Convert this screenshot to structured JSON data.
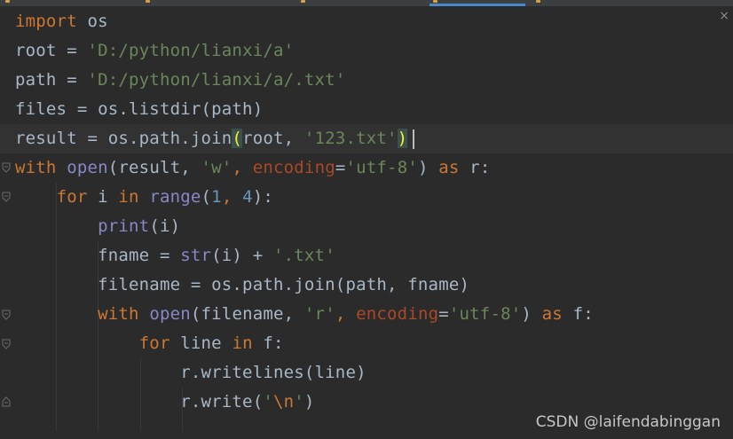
{
  "editor": {
    "close_glyph": "×",
    "lines": [
      {
        "tokens": [
          {
            "t": "import",
            "c": "kw"
          },
          {
            "t": " os",
            "c": ""
          }
        ]
      },
      {
        "tokens": [
          {
            "t": "root = ",
            "c": ""
          },
          {
            "t": "'D:/python/lianxi/a'",
            "c": "str"
          }
        ]
      },
      {
        "tokens": [
          {
            "t": "path = ",
            "c": ""
          },
          {
            "t": "'D:/python/lianxi/a/.txt'",
            "c": "str"
          }
        ]
      },
      {
        "tokens": [
          {
            "t": "files = os.listdir(path)",
            "c": ""
          }
        ]
      },
      {
        "tokens": [
          {
            "t": "result = os.path.join",
            "c": ""
          },
          {
            "t": "(",
            "c": "paren-hl"
          },
          {
            "t": "root, ",
            "c": ""
          },
          {
            "t": "'123.txt'",
            "c": "str"
          },
          {
            "t": ")",
            "c": "paren-hl"
          }
        ],
        "current": true
      },
      {
        "tokens": [
          {
            "t": "with",
            "c": "kw"
          },
          {
            "t": " ",
            "c": ""
          },
          {
            "t": "open",
            "c": "bi"
          },
          {
            "t": "(result, ",
            "c": ""
          },
          {
            "t": "'w'",
            "c": "str"
          },
          {
            "t": ", ",
            "c": "kw"
          },
          {
            "t": "encoding",
            "c": "kwarg"
          },
          {
            "t": "=",
            "c": ""
          },
          {
            "t": "'utf-8'",
            "c": "str"
          },
          {
            "t": ") ",
            "c": ""
          },
          {
            "t": "as",
            "c": "kw"
          },
          {
            "t": " r:",
            "c": ""
          }
        ]
      },
      {
        "tokens": [
          {
            "t": "    ",
            "c": ""
          },
          {
            "t": "for",
            "c": "kw"
          },
          {
            "t": " i ",
            "c": ""
          },
          {
            "t": "in",
            "c": "kw"
          },
          {
            "t": " ",
            "c": ""
          },
          {
            "t": "range",
            "c": "bi"
          },
          {
            "t": "(",
            "c": ""
          },
          {
            "t": "1",
            "c": "num"
          },
          {
            "t": ", ",
            "c": "kw"
          },
          {
            "t": "4",
            "c": "num"
          },
          {
            "t": "):",
            "c": ""
          }
        ]
      },
      {
        "tokens": [
          {
            "t": "        ",
            "c": ""
          },
          {
            "t": "print",
            "c": "bi"
          },
          {
            "t": "(i)",
            "c": ""
          }
        ]
      },
      {
        "tokens": [
          {
            "t": "        fname = ",
            "c": ""
          },
          {
            "t": "str",
            "c": "bi"
          },
          {
            "t": "(i) + ",
            "c": ""
          },
          {
            "t": "'.txt'",
            "c": "str"
          }
        ]
      },
      {
        "tokens": [
          {
            "t": "        filename = os.path.join(path, fname)",
            "c": ""
          }
        ]
      },
      {
        "tokens": [
          {
            "t": "        ",
            "c": ""
          },
          {
            "t": "with",
            "c": "kw"
          },
          {
            "t": " ",
            "c": ""
          },
          {
            "t": "open",
            "c": "bi"
          },
          {
            "t": "(filename, ",
            "c": ""
          },
          {
            "t": "'r'",
            "c": "str"
          },
          {
            "t": ", ",
            "c": "kw"
          },
          {
            "t": "encoding",
            "c": "kwarg"
          },
          {
            "t": "=",
            "c": ""
          },
          {
            "t": "'utf-8'",
            "c": "str"
          },
          {
            "t": ") ",
            "c": ""
          },
          {
            "t": "as",
            "c": "kw"
          },
          {
            "t": " f:",
            "c": ""
          }
        ]
      },
      {
        "tokens": [
          {
            "t": "            ",
            "c": ""
          },
          {
            "t": "for",
            "c": "kw"
          },
          {
            "t": " line ",
            "c": ""
          },
          {
            "t": "in",
            "c": "kw"
          },
          {
            "t": " f:",
            "c": ""
          }
        ]
      },
      {
        "tokens": [
          {
            "t": "                r.writelines(line)",
            "c": ""
          }
        ]
      },
      {
        "tokens": [
          {
            "t": "                r.write(",
            "c": ""
          },
          {
            "t": "'",
            "c": "str"
          },
          {
            "t": "\\n",
            "c": "kw"
          },
          {
            "t": "'",
            "c": "str"
          },
          {
            "t": ")",
            "c": ""
          }
        ]
      }
    ]
  },
  "watermark": "CSDN @laifendabinggan",
  "colors": {
    "background": "#2b2b2b",
    "keyword": "#cc7832",
    "string": "#6a8759",
    "number": "#6897bb",
    "builtin": "#8888c6",
    "kwarg": "#aa4926",
    "default": "#a9b7c6"
  }
}
